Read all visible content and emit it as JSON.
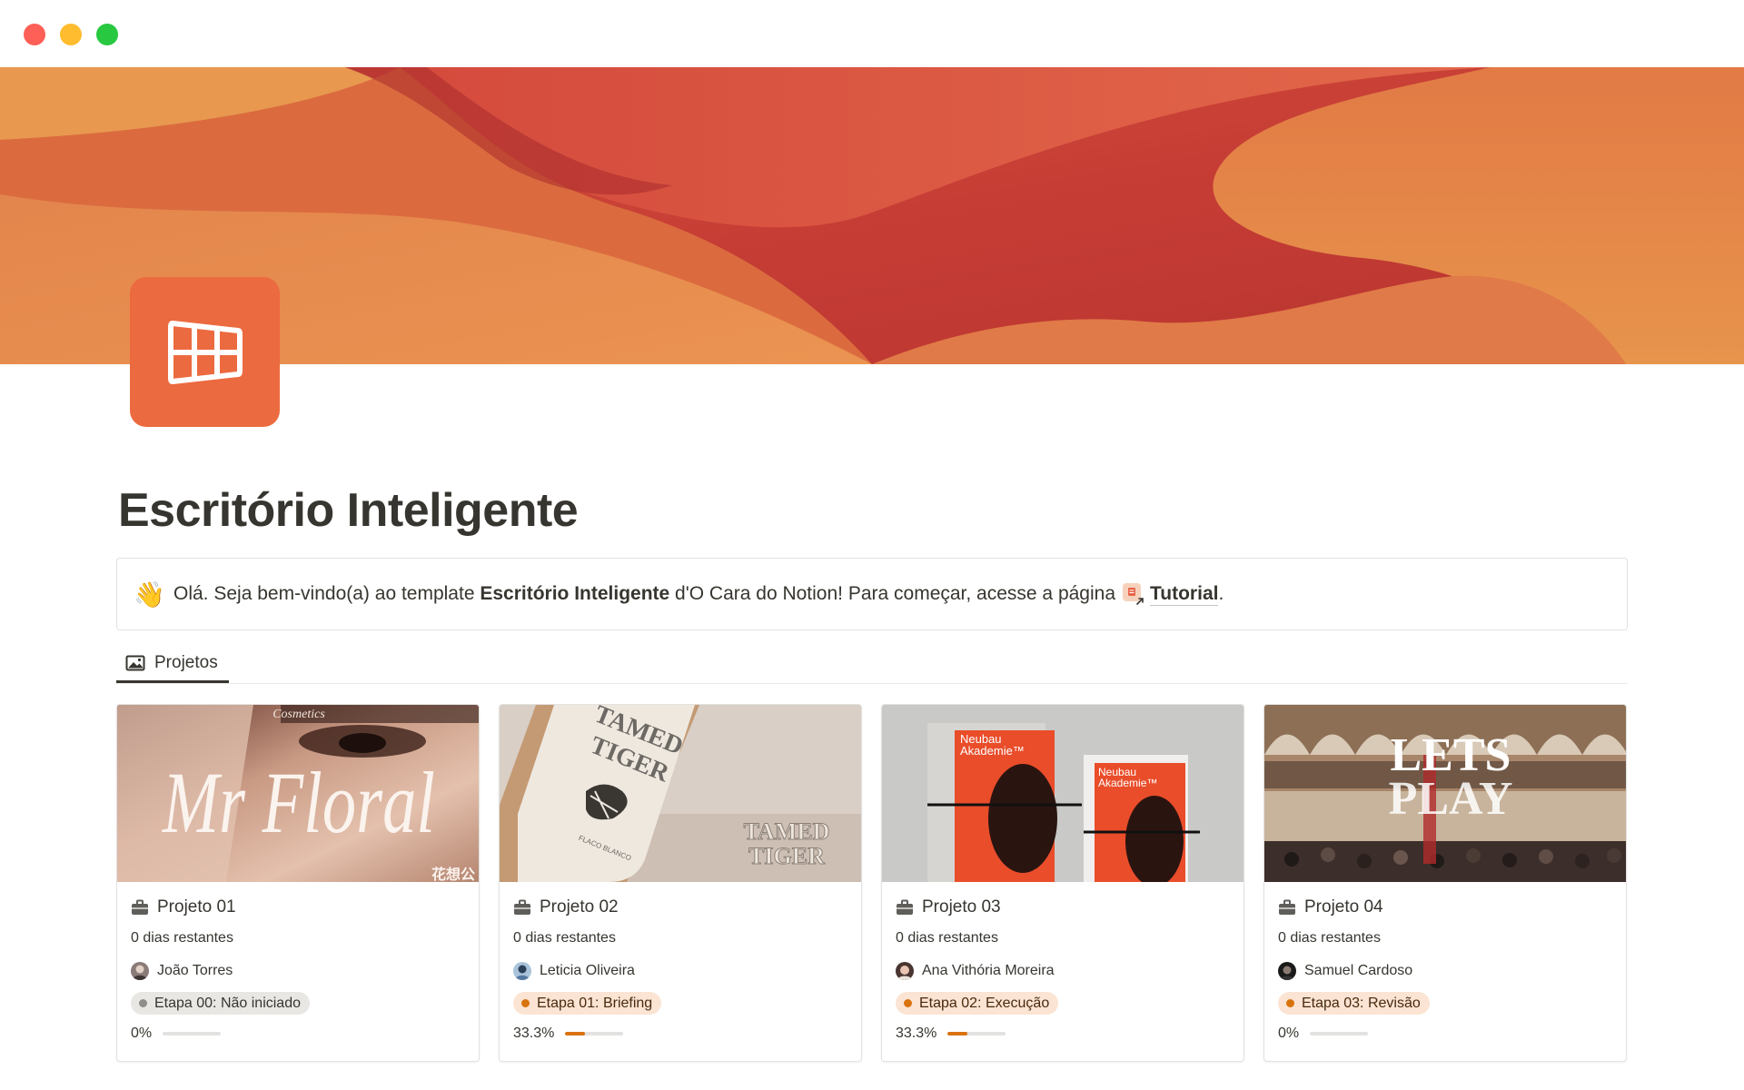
{
  "window": {
    "controls": [
      "close",
      "minimize",
      "zoom"
    ]
  },
  "page": {
    "title": "Escritório Inteligente",
    "icon": "table-grid-icon",
    "accent_color": "#ec6a3f"
  },
  "callout": {
    "emoji": "👋",
    "text_before": "Olá. Seja bem-vindo(a) ao template ",
    "bold_name": "Escritório Inteligente",
    "text_middle": " d'O Cara do Notion! Para começar, acesse a página",
    "link_label": "Tutorial",
    "text_end": "."
  },
  "view": {
    "tab_label": "Projetos",
    "tab_icon": "gallery-image-icon"
  },
  "cards": [
    {
      "title": "Projeto 01",
      "days": "0 dias restantes",
      "person": "João Torres",
      "stage": "Etapa 00: Não iniciado",
      "stage_color": "gray",
      "progress_label": "0%",
      "progress": 0,
      "cover_text": "Mr Floral",
      "cover_small_text": "Cosmetics",
      "cover_cjk_text": "花想公"
    },
    {
      "title": "Projeto 02",
      "days": "0 dias restantes",
      "person": "Leticia Oliveira",
      "stage": "Etapa 01: Briefing",
      "stage_color": "orange",
      "progress_label": "33.3%",
      "progress": 0.333,
      "cover_text": "TAMED TIGER",
      "cover_text_line1": "TAMED",
      "cover_text_line2": "TIGER",
      "cover_small_text": "FLACO BLANCO"
    },
    {
      "title": "Projeto 03",
      "days": "0 dias restantes",
      "person": "Ana Vithória Moreira",
      "stage": "Etapa 02: Execução",
      "stage_color": "orange",
      "progress_label": "33.3%",
      "progress": 0.333,
      "cover_text_line1": "Neubau",
      "cover_text_line2": "Akademie™"
    },
    {
      "title": "Projeto 04",
      "days": "0 dias restantes",
      "person": "Samuel Cardoso",
      "stage": "Etapa 03: Revisão",
      "stage_color": "orange",
      "progress_label": "0%",
      "progress": 0,
      "cover_text_line1": "LETS",
      "cover_text_line2": "PLAY"
    }
  ]
}
